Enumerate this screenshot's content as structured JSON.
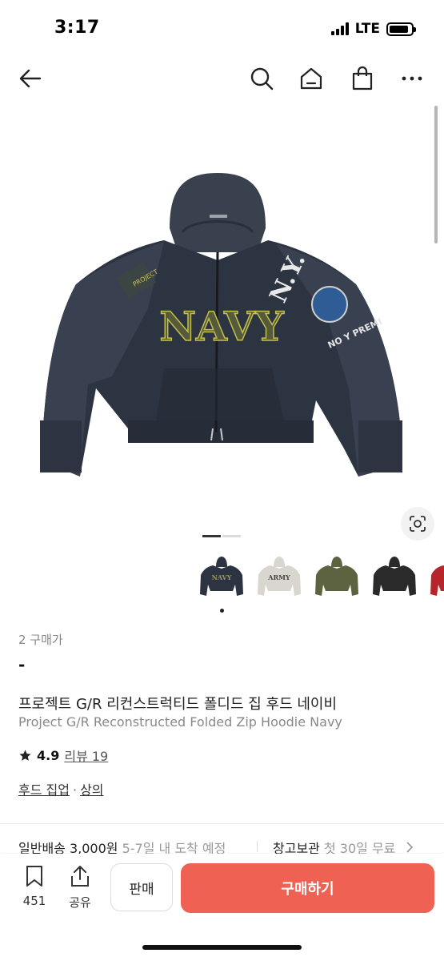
{
  "status_bar": {
    "time": "3:17",
    "network": "LTE",
    "battery_level": 0.9
  },
  "nav": {
    "icons": [
      "back-arrow-icon",
      "search-icon",
      "home-icon",
      "shopping-bag-icon",
      "more-icon"
    ]
  },
  "product_image": {
    "hoodie_text": "NAVY",
    "sleeve_text_1": "N.Y.",
    "sleeve_text_2": "NO Y PREMI",
    "pager_total": 2,
    "pager_active": 1
  },
  "thumbnails": [
    {
      "name": "navy",
      "color": "#2c3442",
      "text": "NAVY"
    },
    {
      "name": "army-gray",
      "color": "#d9d6cf",
      "text": "ARMY"
    },
    {
      "name": "olive",
      "color": "#5d6340",
      "text": ""
    },
    {
      "name": "black",
      "color": "#2a2a2a",
      "text": ""
    },
    {
      "name": "red",
      "color": "#b5252b",
      "text": ""
    }
  ],
  "product": {
    "trade_count": "2 구매가",
    "price": "-",
    "title_ko": "프로젝트 G/R 리컨스트럭티드 폴디드 집 후드 네이비",
    "title_en": "Project G/R Reconstructed Folded Zip Hoodie Navy",
    "rating": "4.9",
    "reviews": "리뷰 19",
    "category_1": "후드 집업",
    "category_sep": "·",
    "category_2": "상의"
  },
  "shipping": {
    "normal_label": "일반배송 3,000원",
    "normal_eta": "5-7일 내 도착 예정",
    "warehouse_label": "창고보관",
    "warehouse_free": "첫 30일 무료"
  },
  "bottom_bar": {
    "bookmark_count": "451",
    "share_label": "공유",
    "sell_label": "판매",
    "buy_label": "구매하기"
  },
  "colors": {
    "accent": "#ef6253",
    "muted": "#888888"
  }
}
